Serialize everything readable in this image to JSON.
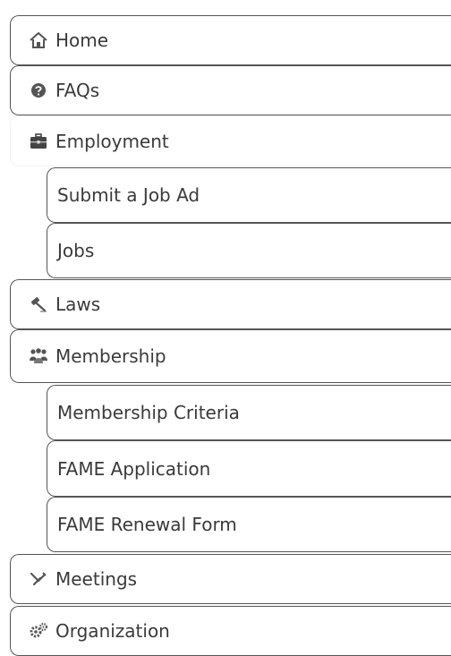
{
  "nav": {
    "items": [
      {
        "label": "Home",
        "icon": "home-icon"
      },
      {
        "label": "FAQs",
        "icon": "question-circle-icon"
      },
      {
        "label": "Employment",
        "icon": "briefcase-icon"
      },
      {
        "label": "Laws",
        "icon": "gavel-icon"
      },
      {
        "label": "Membership",
        "icon": "people-group-icon"
      },
      {
        "label": "Meetings",
        "icon": "handshake-icon"
      },
      {
        "label": "Organization",
        "icon": "gears-icon"
      }
    ],
    "employment_sub": [
      {
        "label": "Submit a Job Ad"
      },
      {
        "label": "Jobs"
      }
    ],
    "membership_sub": [
      {
        "label": "Membership Criteria"
      },
      {
        "label": "FAME Application"
      },
      {
        "label": "FAME Renewal Form"
      }
    ]
  },
  "colors": {
    "border": "#555555",
    "text": "#3a3a3a",
    "active_border": "#f1f1f1"
  }
}
